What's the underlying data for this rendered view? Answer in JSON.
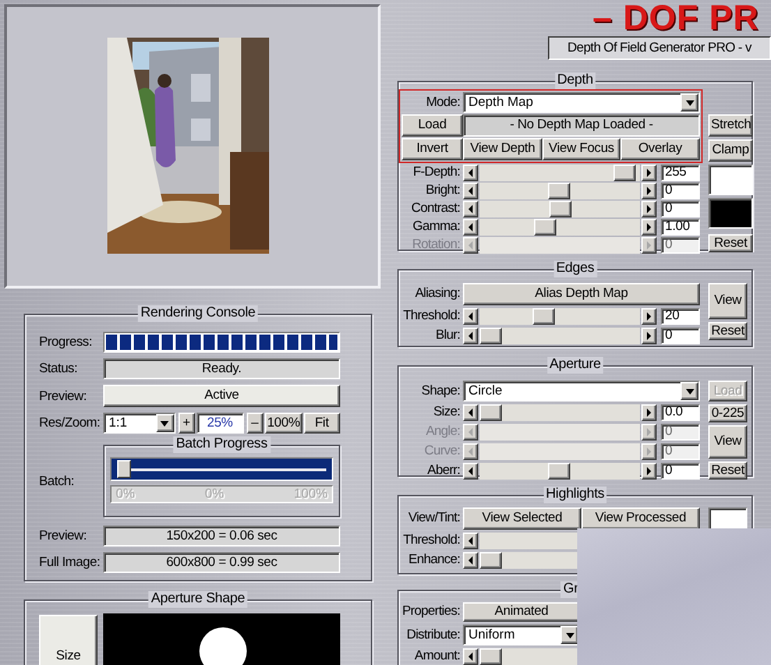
{
  "header": {
    "logo": "– DOF PR",
    "subtitle": "Depth Of Field Generator PRO - v"
  },
  "rendering_console": {
    "title": "Rendering Console",
    "progress": {
      "label": "Progress:",
      "level": 1
    },
    "status": {
      "label": "Status:",
      "value": "Ready."
    },
    "preview": {
      "label": "Preview:",
      "value": "Active"
    },
    "res_zoom": {
      "label": "Res/Zoom:",
      "resolution": "1:1",
      "zoom_in": "+",
      "zoom": "25%",
      "zoom_out": "–",
      "actual_size": "100%",
      "fit": "Fit"
    },
    "batch_progress": {
      "title": "Batch Progress",
      "label": "Batch:",
      "level": 0,
      "scale": [
        "0%",
        "0%",
        "100%"
      ]
    },
    "timings": [
      {
        "label": "Preview:",
        "value": "150x200 = 0.06 sec"
      },
      {
        "label": "Full Image:",
        "value": "600x800 = 0.99 sec"
      }
    ]
  },
  "aperture_shape": {
    "title": "Aperture Shape",
    "size_button": "Size"
  },
  "depth": {
    "title": "Depth",
    "highlighted": true,
    "mode_label": "Mode:",
    "mode": "Depth Map",
    "load": "Load",
    "map_status": "- No Depth Map Loaded -",
    "view_buttons": [
      "Invert",
      "View Depth",
      "View Focus",
      "Overlay"
    ],
    "stretch": "Stretch",
    "clamp": "Clamp",
    "sliders": [
      {
        "label": "F-Depth:",
        "level": 0.97,
        "value": "255",
        "disabled": false
      },
      {
        "label": "Bright:",
        "level": 0.49,
        "value": "0",
        "disabled": false
      },
      {
        "label": "Contrast:",
        "level": 0.5,
        "value": "0",
        "disabled": false
      },
      {
        "label": "Gamma:",
        "level": 0.39,
        "value": "1.00",
        "disabled": false
      },
      {
        "label": "Rotation:",
        "value": "0",
        "disabled": true
      }
    ],
    "swatches": [
      {
        "color": "#ffffff"
      },
      {
        "color": "#000000"
      }
    ],
    "reset": "Reset"
  },
  "edges": {
    "title": "Edges",
    "aliasing_label": "Aliasing:",
    "aliasing": "Alias Depth Map",
    "sliders": [
      {
        "label": "Threshold:",
        "level": 0.38,
        "value": "20",
        "disabled": false
      },
      {
        "label": "Blur:",
        "level": 0,
        "value": "0",
        "disabled": false
      }
    ],
    "view": "View",
    "reset": "Reset"
  },
  "aperture": {
    "title": "Aperture",
    "shape_label": "Shape:",
    "shape": "Circle",
    "load": {
      "label": "Load",
      "disabled": true
    },
    "range": "0-225",
    "sliders": [
      {
        "label": "Size:",
        "level": 0,
        "value": "0.0",
        "disabled": false
      },
      {
        "label": "Angle:",
        "value": "0",
        "disabled": true
      },
      {
        "label": "Curve:",
        "value": "0",
        "disabled": true
      },
      {
        "label": "Aberr:",
        "level": 0.49,
        "value": "0",
        "disabled": false
      }
    ],
    "view": "View",
    "reset": "Reset"
  },
  "highlights": {
    "title": "Highlights",
    "view_tint_label": "View/Tint:",
    "view_buttons": [
      "View Selected",
      "View Processed"
    ],
    "swatch": {
      "color": "#ffffff"
    },
    "sliders": [
      {
        "label": "Threshold:",
        "disabled": false
      },
      {
        "label": "Enhance:",
        "level": 0,
        "disabled": false
      }
    ]
  },
  "group_5": {
    "title": "Gr",
    "properties_label": "Properties:",
    "properties": "Animated",
    "distribute_label": "Distribute:",
    "distribute": "Uniform",
    "sliders": [
      {
        "label": "Amount:",
        "level": 0,
        "disabled": false
      }
    ]
  }
}
